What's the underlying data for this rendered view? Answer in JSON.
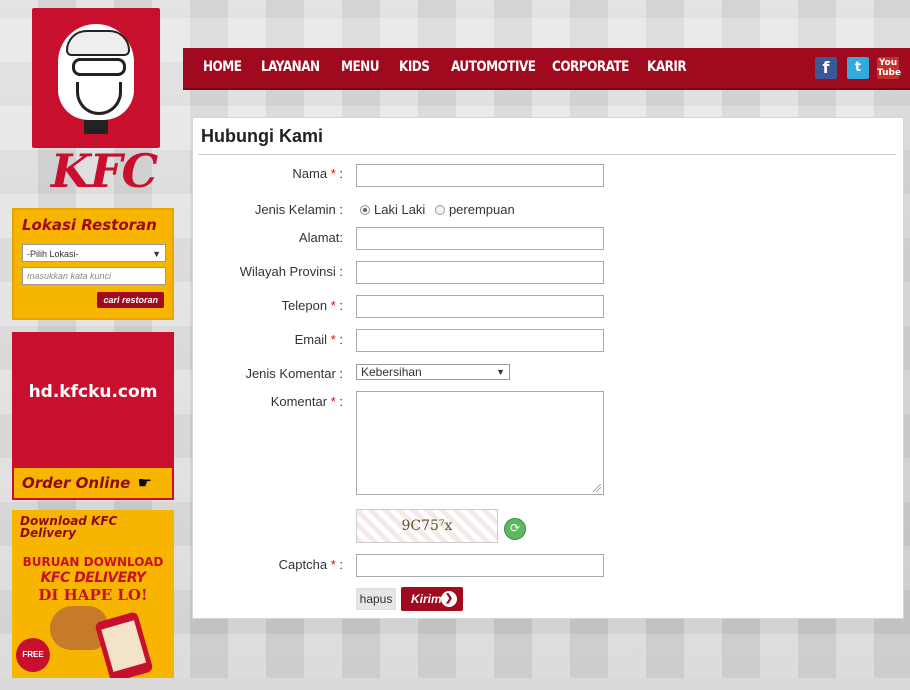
{
  "brand": {
    "logo_text": "KFC"
  },
  "nav": {
    "items": [
      "HOME",
      "LAYANAN",
      "MENU",
      "KIDS",
      "AUTOMOTIVE",
      "CORPORATE",
      "KARIR"
    ],
    "social": [
      {
        "name": "facebook",
        "glyph": "f"
      },
      {
        "name": "twitter",
        "glyph": "t"
      },
      {
        "name": "youtube",
        "glyph": "You Tube"
      }
    ]
  },
  "sidebar": {
    "lokasi": {
      "title": "Lokasi Restoran",
      "select_value": "-Pilih Lokasi-",
      "input_placeholder": "masukkan kata kunci",
      "button": "cari restoran"
    },
    "hd": {
      "site": "hd.kfcku.com",
      "order_label": "Order Online"
    },
    "download": {
      "title": "Download KFC Delivery",
      "line1": "BURUAN DOWNLOAD",
      "line2": "KFC DELIVERY",
      "line3": "DI HAPE LO!",
      "badge": "FREE"
    }
  },
  "form": {
    "title": "Hubungi Kami",
    "required_mark": "*",
    "labels": {
      "nama": "Nama",
      "jenis_kelamin": "Jenis Kelamin :",
      "alamat": "Alamat:",
      "wilayah": "Wilayah Provinsi :",
      "telepon": "Telepon",
      "email": "Email",
      "jenis_komentar": "Jenis Komentar :",
      "komentar": "Komentar",
      "captcha": "Captcha"
    },
    "gender_options": [
      "Laki Laki",
      "perempuan"
    ],
    "gender_selected": "Laki Laki",
    "jenis_komentar_value": "Kebersihan",
    "captcha_text": "9C75⁷x",
    "buttons": {
      "hapus": "hapus",
      "kirim": "Kirim"
    }
  },
  "colors": {
    "kfc_red": "#a00a1f",
    "kfc_yellow": "#f7b500",
    "required": "#e00000"
  }
}
